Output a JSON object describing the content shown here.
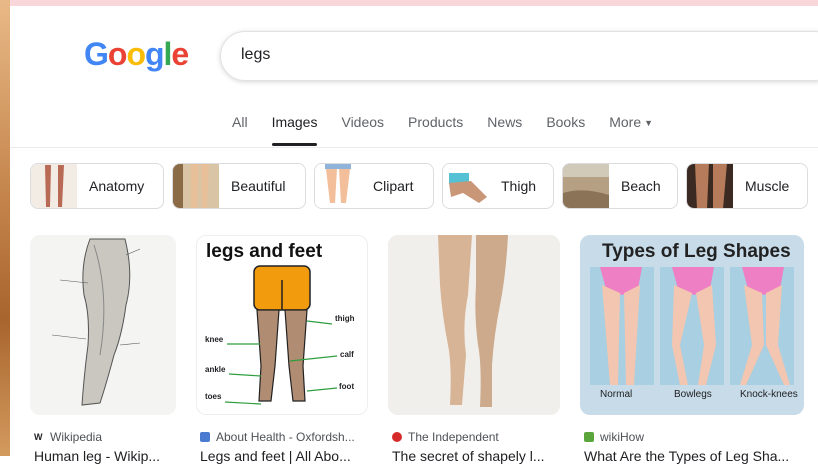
{
  "search": {
    "query": "legs"
  },
  "tabs": [
    {
      "label": "All"
    },
    {
      "label": "Images"
    },
    {
      "label": "Videos"
    },
    {
      "label": "Products"
    },
    {
      "label": "News"
    },
    {
      "label": "Books"
    },
    {
      "label": "More"
    }
  ],
  "chips": [
    {
      "label": "Anatomy"
    },
    {
      "label": "Beautiful"
    },
    {
      "label": "Clipart"
    },
    {
      "label": "Thigh"
    },
    {
      "label": "Beach"
    },
    {
      "label": "Muscle"
    }
  ],
  "results": [
    {
      "source": "Wikipedia",
      "title": "Human leg - Wikip..."
    },
    {
      "source": "About Health - Oxfordsh...",
      "title": "Legs and feet | All Abo...",
      "img_heading": "legs and feet",
      "labels": [
        "thigh",
        "knee",
        "calf",
        "ankle",
        "toes",
        "foot"
      ]
    },
    {
      "source": "The Independent",
      "title": "The secret of shapely l..."
    },
    {
      "source": "wikiHow",
      "title": "What Are the Types of Leg Sha...",
      "img_heading": "Types of Leg Shapes",
      "labels": [
        "Normal",
        "Bowlegs",
        "Knock-knees"
      ]
    }
  ],
  "colors": {
    "logo_blue": "#4285f4",
    "logo_red": "#ea4335",
    "logo_yellow": "#fbbc05",
    "logo_green": "#34a853"
  }
}
